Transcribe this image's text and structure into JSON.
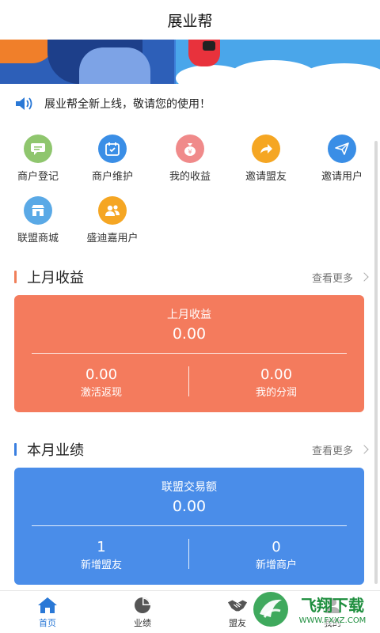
{
  "header": {
    "title": "展业帮"
  },
  "notice": {
    "text": "展业帮全新上线，敬请您的使用！",
    "icon": "speaker-icon"
  },
  "menu": [
    {
      "label": "商户登记",
      "icon": "chat-icon",
      "color": "#8fc66e"
    },
    {
      "label": "商户维护",
      "icon": "calendar-icon",
      "color": "#3a8ee6"
    },
    {
      "label": "我的收益",
      "icon": "money-bag-icon",
      "color": "#f08a8a"
    },
    {
      "label": "邀请盟友",
      "icon": "share-arrow-icon",
      "color": "#f5a623"
    },
    {
      "label": "邀请用户",
      "icon": "paper-plane-icon",
      "color": "#3a8ee6"
    },
    {
      "label": "联盟商城",
      "icon": "shop-icon",
      "color": "#5aa9e6"
    },
    {
      "label": "盛迪嘉用户",
      "icon": "users-icon",
      "color": "#f5a623"
    }
  ],
  "last_month": {
    "section_title": "上月收益",
    "more_label": "查看更多",
    "bar_color": "#f07f5a",
    "card_color": "#f47b5d",
    "card_title": "上月收益",
    "card_value": "0.00",
    "left_value": "0.00",
    "left_label": "激活返现",
    "right_value": "0.00",
    "right_label": "我的分润"
  },
  "this_month": {
    "section_title": "本月业绩",
    "more_label": "查看更多",
    "bar_color": "#3a7fe0",
    "card_color": "#4a8de9",
    "card_title": "联盟交易额",
    "card_value": "0.00",
    "left_value": "1",
    "left_label": "新增盟友",
    "right_value": "0",
    "right_label": "新增商户"
  },
  "tabbar": {
    "active_color": "#2a78d6",
    "items": [
      {
        "label": "首页",
        "icon": "home-icon",
        "active": true
      },
      {
        "label": "业绩",
        "icon": "pie-chart-icon",
        "active": false
      },
      {
        "label": "盟友",
        "icon": "handshake-icon",
        "active": false
      },
      {
        "label": "我的",
        "icon": "person-icon",
        "active": false
      }
    ]
  },
  "watermark": {
    "brand": "飞翔下载",
    "url": "WWW.FXXZ.COM"
  }
}
